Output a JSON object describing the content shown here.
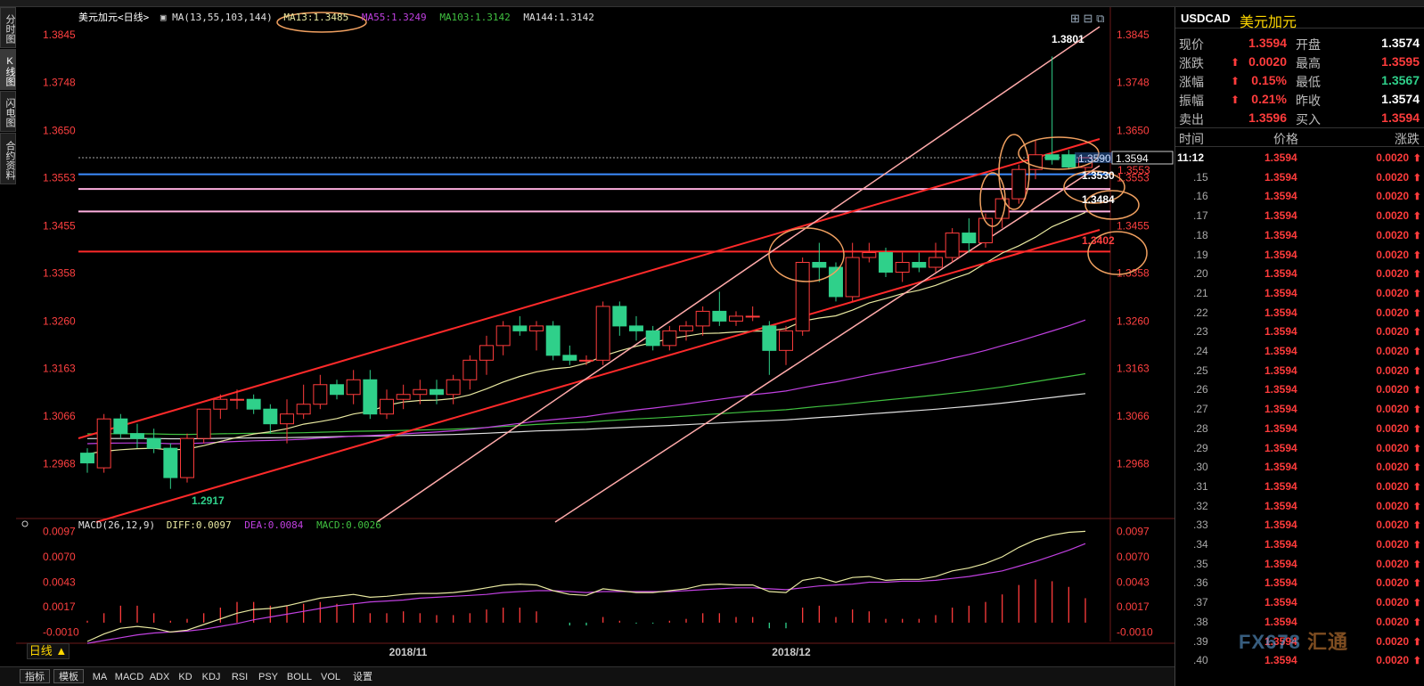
{
  "instrument": {
    "title": "美元加元<日线>",
    "symbol": "USDCAD",
    "name_cn": "美元加元"
  },
  "indicators": {
    "ma": {
      "label": "MA(13,55,103,144)",
      "ma13": "MA13:1.3485",
      "ma55": "MA55:1.3249",
      "ma103": "MA103:1.3142",
      "ma144": "MA144:1.3142"
    },
    "macd": {
      "label": "MACD(26,12,9)",
      "diff": "DIFF:0.0097",
      "dea": "DEA:0.0084",
      "macd": "MACD:0.0026"
    }
  },
  "left_tabs": [
    "分时图",
    "K线图",
    "闪电图",
    "合约资料"
  ],
  "price_axis": [
    "1.3845",
    "1.3748",
    "1.3650",
    "1.3553",
    "1.3455",
    "1.3358",
    "1.3260",
    "1.3163",
    "1.3066",
    "1.2968"
  ],
  "macd_axis": [
    "0.0097",
    "0.0070",
    "0.0043",
    "0.0017",
    "-0.0010"
  ],
  "date_labels": [
    "2018/11",
    "2018/12"
  ],
  "annotations": {
    "high": "1.3801",
    "low": "1.2917",
    "current": "1.3594",
    "l1": "1.3553",
    "l2": "1.3530",
    "l3": "1.3484",
    "l4": "1.3402",
    "last_partial": "1.3590"
  },
  "quote": [
    {
      "l": "现价",
      "v": "1.3594",
      "l2": "开盘",
      "v2": "1.3574"
    },
    {
      "l": "涨跌",
      "v": "0.0020",
      "l2": "最高",
      "v2": "1.3595"
    },
    {
      "l": "涨幅",
      "v": "0.15%",
      "l2": "最低",
      "v2": "1.3567"
    },
    {
      "l": "振幅",
      "v": "0.21%",
      "l2": "昨收",
      "v2": "1.3574"
    },
    {
      "l": "卖出",
      "v": "1.3596",
      "l2": "买入",
      "v2": "1.3594"
    }
  ],
  "ticks_header": {
    "time": "时间",
    "price": "价格",
    "change": "涨跌"
  },
  "ticks": [
    {
      "t": "11:12",
      "p": "1.3594",
      "c": "0.0020"
    },
    {
      "t": ".15",
      "p": "1.3594",
      "c": "0.0020"
    },
    {
      "t": ".16",
      "p": "1.3594",
      "c": "0.0020"
    },
    {
      "t": ".17",
      "p": "1.3594",
      "c": "0.0020"
    },
    {
      "t": ".18",
      "p": "1.3594",
      "c": "0.0020"
    },
    {
      "t": ".19",
      "p": "1.3594",
      "c": "0.0020"
    },
    {
      "t": ".20",
      "p": "1.3594",
      "c": "0.0020"
    },
    {
      "t": ".21",
      "p": "1.3594",
      "c": "0.0020"
    },
    {
      "t": ".22",
      "p": "1.3594",
      "c": "0.0020"
    },
    {
      "t": ".23",
      "p": "1.3594",
      "c": "0.0020"
    },
    {
      "t": ".24",
      "p": "1.3594",
      "c": "0.0020"
    },
    {
      "t": ".25",
      "p": "1.3594",
      "c": "0.0020"
    },
    {
      "t": ".26",
      "p": "1.3594",
      "c": "0.0020"
    },
    {
      "t": ".27",
      "p": "1.3594",
      "c": "0.0020"
    },
    {
      "t": ".28",
      "p": "1.3594",
      "c": "0.0020"
    },
    {
      "t": ".29",
      "p": "1.3594",
      "c": "0.0020"
    },
    {
      "t": ".30",
      "p": "1.3594",
      "c": "0.0020"
    },
    {
      "t": ".31",
      "p": "1.3594",
      "c": "0.0020"
    },
    {
      "t": ".32",
      "p": "1.3594",
      "c": "0.0020"
    },
    {
      "t": ".33",
      "p": "1.3594",
      "c": "0.0020"
    },
    {
      "t": ".34",
      "p": "1.3594",
      "c": "0.0020"
    },
    {
      "t": ".35",
      "p": "1.3594",
      "c": "0.0020"
    },
    {
      "t": ".36",
      "p": "1.3594",
      "c": "0.0020"
    },
    {
      "t": ".37",
      "p": "1.3594",
      "c": "0.0020"
    },
    {
      "t": ".38",
      "p": "1.3594",
      "c": "0.0020"
    },
    {
      "t": ".39",
      "p": "1.3594",
      "c": "0.0020"
    },
    {
      "t": ".40",
      "p": "1.3594",
      "c": "0.0020"
    }
  ],
  "bottom_tabs": [
    "指标",
    "模板",
    "MA",
    "MACD",
    "ADX",
    "KD",
    "KDJ",
    "RSI",
    "PSY",
    "BOLL",
    "VOL",
    "设置"
  ],
  "period_button": "日线 ▲",
  "watermark": {
    "a": "FX678",
    "b": "汇通"
  },
  "colors": {
    "up": "#ff3c3c",
    "down": "#2fd08a",
    "ma13": "#e8e8a0",
    "ma55": "#c040e0",
    "ma103": "#40c040",
    "ma144": "#e0e0e0",
    "diff": "#e8e8a0",
    "dea": "#c040e0",
    "bg": "#000000"
  },
  "chart_data": {
    "type": "candlestick",
    "price_range": [
      1.286,
      1.388
    ],
    "candles": [
      {
        "o": 1.299,
        "h": 1.3,
        "l": 1.295,
        "c": 1.297
      },
      {
        "o": 1.296,
        "h": 1.307,
        "l": 1.295,
        "c": 1.306
      },
      {
        "o": 1.306,
        "h": 1.307,
        "l": 1.302,
        "c": 1.303
      },
      {
        "o": 1.303,
        "h": 1.305,
        "l": 1.3,
        "c": 1.302
      },
      {
        "o": 1.302,
        "h": 1.304,
        "l": 1.299,
        "c": 1.3
      },
      {
        "o": 1.3,
        "h": 1.301,
        "l": 1.2917,
        "c": 1.294
      },
      {
        "o": 1.294,
        "h": 1.303,
        "l": 1.293,
        "c": 1.302
      },
      {
        "o": 1.302,
        "h": 1.308,
        "l": 1.301,
        "c": 1.308
      },
      {
        "o": 1.308,
        "h": 1.311,
        "l": 1.306,
        "c": 1.31
      },
      {
        "o": 1.31,
        "h": 1.312,
        "l": 1.308,
        "c": 1.31
      },
      {
        "o": 1.31,
        "h": 1.311,
        "l": 1.307,
        "c": 1.308
      },
      {
        "o": 1.308,
        "h": 1.309,
        "l": 1.303,
        "c": 1.305
      },
      {
        "o": 1.305,
        "h": 1.31,
        "l": 1.301,
        "c": 1.307
      },
      {
        "o": 1.307,
        "h": 1.313,
        "l": 1.306,
        "c": 1.309
      },
      {
        "o": 1.309,
        "h": 1.315,
        "l": 1.308,
        "c": 1.313
      },
      {
        "o": 1.313,
        "h": 1.314,
        "l": 1.31,
        "c": 1.311
      },
      {
        "o": 1.311,
        "h": 1.316,
        "l": 1.309,
        "c": 1.314
      },
      {
        "o": 1.314,
        "h": 1.316,
        "l": 1.306,
        "c": 1.307
      },
      {
        "o": 1.307,
        "h": 1.312,
        "l": 1.306,
        "c": 1.31
      },
      {
        "o": 1.31,
        "h": 1.313,
        "l": 1.308,
        "c": 1.311
      },
      {
        "o": 1.311,
        "h": 1.314,
        "l": 1.309,
        "c": 1.312
      },
      {
        "o": 1.312,
        "h": 1.314,
        "l": 1.309,
        "c": 1.311
      },
      {
        "o": 1.311,
        "h": 1.315,
        "l": 1.309,
        "c": 1.314
      },
      {
        "o": 1.314,
        "h": 1.319,
        "l": 1.312,
        "c": 1.318
      },
      {
        "o": 1.318,
        "h": 1.323,
        "l": 1.315,
        "c": 1.321
      },
      {
        "o": 1.321,
        "h": 1.326,
        "l": 1.319,
        "c": 1.325
      },
      {
        "o": 1.325,
        "h": 1.327,
        "l": 1.323,
        "c": 1.324
      },
      {
        "o": 1.324,
        "h": 1.326,
        "l": 1.32,
        "c": 1.325
      },
      {
        "o": 1.325,
        "h": 1.326,
        "l": 1.318,
        "c": 1.319
      },
      {
        "o": 1.319,
        "h": 1.321,
        "l": 1.317,
        "c": 1.318
      },
      {
        "o": 1.318,
        "h": 1.319,
        "l": 1.317,
        "c": 1.318
      },
      {
        "o": 1.318,
        "h": 1.33,
        "l": 1.317,
        "c": 1.329
      },
      {
        "o": 1.329,
        "h": 1.33,
        "l": 1.323,
        "c": 1.325
      },
      {
        "o": 1.325,
        "h": 1.327,
        "l": 1.322,
        "c": 1.324
      },
      {
        "o": 1.324,
        "h": 1.325,
        "l": 1.32,
        "c": 1.321
      },
      {
        "o": 1.321,
        "h": 1.325,
        "l": 1.32,
        "c": 1.324
      },
      {
        "o": 1.324,
        "h": 1.326,
        "l": 1.322,
        "c": 1.325
      },
      {
        "o": 1.325,
        "h": 1.329,
        "l": 1.323,
        "c": 1.328
      },
      {
        "o": 1.328,
        "h": 1.332,
        "l": 1.325,
        "c": 1.326
      },
      {
        "o": 1.326,
        "h": 1.328,
        "l": 1.325,
        "c": 1.327
      },
      {
        "o": 1.327,
        "h": 1.329,
        "l": 1.326,
        "c": 1.327
      },
      {
        "o": 1.325,
        "h": 1.326,
        "l": 1.315,
        "c": 1.32
      },
      {
        "o": 1.32,
        "h": 1.325,
        "l": 1.317,
        "c": 1.324
      },
      {
        "o": 1.324,
        "h": 1.339,
        "l": 1.323,
        "c": 1.338
      },
      {
        "o": 1.338,
        "h": 1.342,
        "l": 1.334,
        "c": 1.337
      },
      {
        "o": 1.337,
        "h": 1.338,
        "l": 1.33,
        "c": 1.331
      },
      {
        "o": 1.331,
        "h": 1.342,
        "l": 1.33,
        "c": 1.339
      },
      {
        "o": 1.339,
        "h": 1.342,
        "l": 1.338,
        "c": 1.34
      },
      {
        "o": 1.34,
        "h": 1.341,
        "l": 1.335,
        "c": 1.336
      },
      {
        "o": 1.336,
        "h": 1.34,
        "l": 1.334,
        "c": 1.338
      },
      {
        "o": 1.338,
        "h": 1.34,
        "l": 1.336,
        "c": 1.337
      },
      {
        "o": 1.337,
        "h": 1.342,
        "l": 1.336,
        "c": 1.339
      },
      {
        "o": 1.339,
        "h": 1.345,
        "l": 1.338,
        "c": 1.344
      },
      {
        "o": 1.344,
        "h": 1.347,
        "l": 1.34,
        "c": 1.342
      },
      {
        "o": 1.342,
        "h": 1.348,
        "l": 1.341,
        "c": 1.347
      },
      {
        "o": 1.347,
        "h": 1.352,
        "l": 1.345,
        "c": 1.351
      },
      {
        "o": 1.351,
        "h": 1.358,
        "l": 1.35,
        "c": 1.357
      },
      {
        "o": 1.357,
        "h": 1.363,
        "l": 1.355,
        "c": 1.36
      },
      {
        "o": 1.36,
        "h": 1.3801,
        "l": 1.358,
        "c": 1.359
      },
      {
        "o": 1.36,
        "h": 1.361,
        "l": 1.357,
        "c": 1.3575
      },
      {
        "o": 1.3574,
        "h": 1.3595,
        "l": 1.3567,
        "c": 1.3594
      }
    ],
    "macd_range": [
      -0.002,
      0.0105
    ],
    "diff": [
      -0.002,
      -0.0012,
      -0.0006,
      -0.0004,
      -0.0006,
      -0.001,
      -0.0008,
      -0.0002,
      0.0004,
      0.001,
      0.0014,
      0.0015,
      0.0018,
      0.0022,
      0.0026,
      0.0028,
      0.003,
      0.0027,
      0.0028,
      0.003,
      0.0031,
      0.0031,
      0.0032,
      0.0034,
      0.0037,
      0.004,
      0.0041,
      0.004,
      0.0034,
      0.003,
      0.0029,
      0.0036,
      0.0034,
      0.0032,
      0.0032,
      0.0034,
      0.0036,
      0.004,
      0.0041,
      0.004,
      0.004,
      0.0033,
      0.0032,
      0.0045,
      0.0048,
      0.0043,
      0.0048,
      0.0049,
      0.0045,
      0.0046,
      0.0046,
      0.0049,
      0.0055,
      0.0058,
      0.0063,
      0.007,
      0.008,
      0.0088,
      0.0093,
      0.0096,
      0.0097
    ],
    "dea": [
      -0.0022,
      -0.0019,
      -0.0016,
      -0.0013,
      -0.0011,
      -0.001,
      -0.0009,
      -0.0007,
      -0.0004,
      -0.0001,
      0.0003,
      0.0006,
      0.0009,
      0.0012,
      0.0015,
      0.0018,
      0.002,
      0.0022,
      0.0023,
      0.0024,
      0.0026,
      0.0027,
      0.0028,
      0.0029,
      0.003,
      0.0032,
      0.0033,
      0.0034,
      0.0034,
      0.0033,
      0.0032,
      0.0033,
      0.0033,
      0.0033,
      0.0033,
      0.0033,
      0.0034,
      0.0035,
      0.0036,
      0.0037,
      0.0037,
      0.0036,
      0.0035,
      0.0037,
      0.0039,
      0.004,
      0.0041,
      0.0043,
      0.0043,
      0.0044,
      0.0044,
      0.0045,
      0.0047,
      0.0049,
      0.0052,
      0.0055,
      0.006,
      0.0065,
      0.0071,
      0.0077,
      0.0084
    ],
    "hist": [
      0.0002,
      0.001,
      0.0018,
      0.0018,
      0.001,
      0.0002,
      0.0004,
      0.001,
      0.0016,
      0.0022,
      0.0022,
      0.0018,
      0.0018,
      0.002,
      0.0022,
      0.002,
      0.002,
      0.001,
      0.001,
      0.0012,
      0.001,
      0.0008,
      0.0008,
      0.001,
      0.0014,
      0.0016,
      0.0016,
      0.0012,
      0.0,
      -0.0003,
      -0.0003,
      0.0006,
      0.0002,
      -0.0001,
      -0.0001,
      0.0002,
      0.0004,
      0.001,
      0.001,
      0.0006,
      0.0006,
      -0.0006,
      -0.0006,
      0.0016,
      0.0018,
      0.0006,
      0.0014,
      0.0012,
      0.0004,
      0.0004,
      0.0004,
      0.0008,
      0.0016,
      0.0018,
      0.0022,
      0.003,
      0.004,
      0.0046,
      0.0044,
      0.0038,
      0.0026
    ]
  }
}
